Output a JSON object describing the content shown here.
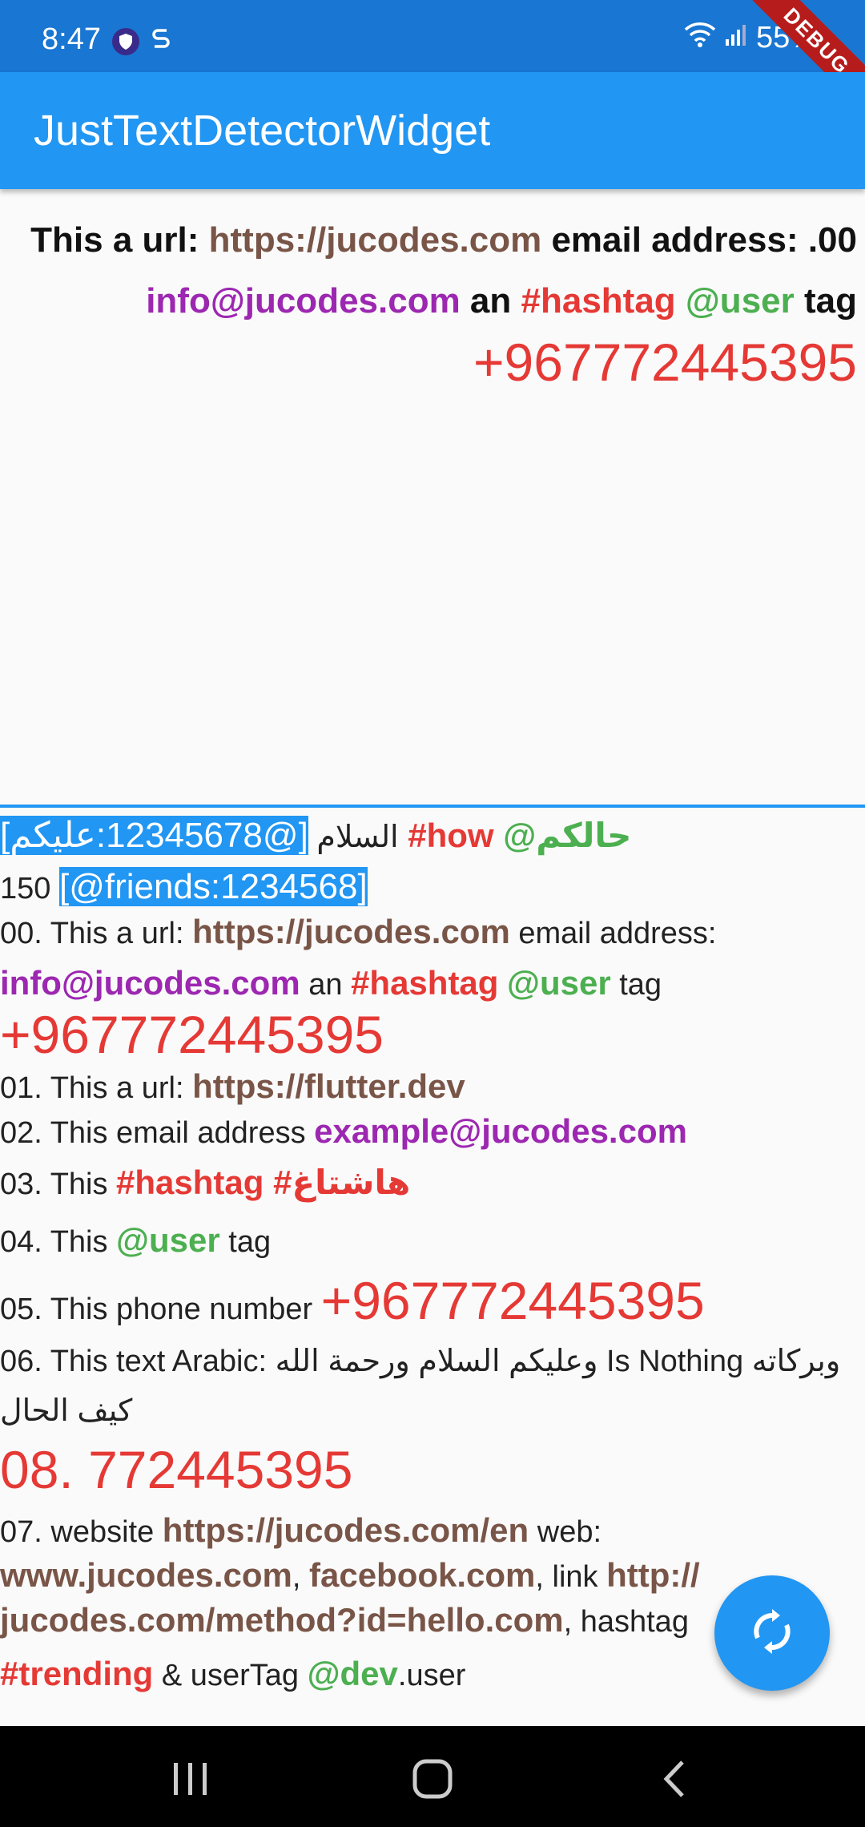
{
  "status": {
    "time": "8:47",
    "battery": "55%",
    "debug_banner": "DEBUG"
  },
  "app_bar": {
    "title": "JustTextDetectorWidget"
  },
  "top_text": {
    "l1": {
      "a": "This  a url: ",
      "url": "https://jucodes.com",
      "b": " email address: .00"
    },
    "l2": {
      "email": "info@jucodes.com",
      "a": " an ",
      "hashtag": "#hashtag",
      "sp": " ",
      "user": "@user",
      "b": " tag"
    },
    "phone": "+967772445395"
  },
  "bottom_text": {
    "r1": {
      "a": "السلام ",
      "sel": "[@12345678:عليكم]",
      "hash": " #how",
      "user": " @حالكم"
    },
    "r2": {
      "a": "150 ",
      "sel": "[@friends:1234568]"
    },
    "r3": {
      "a": "00. This  a url: ",
      "url": "https://jucodes.com",
      "b": " email address:"
    },
    "r4": {
      "email": "info@jucodes.com",
      "a": " an ",
      "hash": "#hashtag",
      "sp": " ",
      "user": "@user",
      "b": " tag"
    },
    "r5": {
      "phone": "+967772445395"
    },
    "r6": {
      "a": "01. This  a url: ",
      "url": "https://flutter.dev"
    },
    "r7": {
      "a": "02. This email address ",
      "email": "example@jucodes.com"
    },
    "r8": {
      "a": "03. This  ",
      "hash": "#hashtag #هاشتاغ"
    },
    "r9": {
      "a": "04. This ",
      "user": "@user",
      "b": " tag"
    },
    "r10": {
      "a": "05. This  phone number  ",
      "phone": "+967772445395"
    },
    "r11": {
      "a": "06. This text Arabic: وعليكم السلام ورحمة الله Is Nothing وبركاته"
    },
    "r12": {
      "a": "كيف الحال"
    },
    "r13": {
      "phone": "08. 772445395"
    },
    "r14": {
      "a": "07. website  ",
      "url": "https://jucodes.com/en",
      "b": "  web:"
    },
    "r15": {
      "url1": "www.jucodes.com",
      "a": ",  ",
      "url2": "facebook.com",
      "b": ",  link ",
      "url3": "http://"
    },
    "r16": {
      "url": "jucodes.com/method?id=hello.com",
      "a": ", hashtag"
    },
    "r17": {
      "hash": "#trending",
      "a": " & userTag ",
      "user": "@dev",
      "b": ".user"
    }
  },
  "fab": {
    "icon": "refresh-icon"
  },
  "nav": {
    "recents": "recents-icon",
    "home": "home-icon",
    "back": "back-icon"
  },
  "colors": {
    "app_bar": "#2196f3",
    "status_bar": "#1976d2",
    "url": "#795548",
    "email": "#9c27b0",
    "hashtag": "#e53935",
    "user": "#4caf50",
    "phone": "#e53935"
  }
}
